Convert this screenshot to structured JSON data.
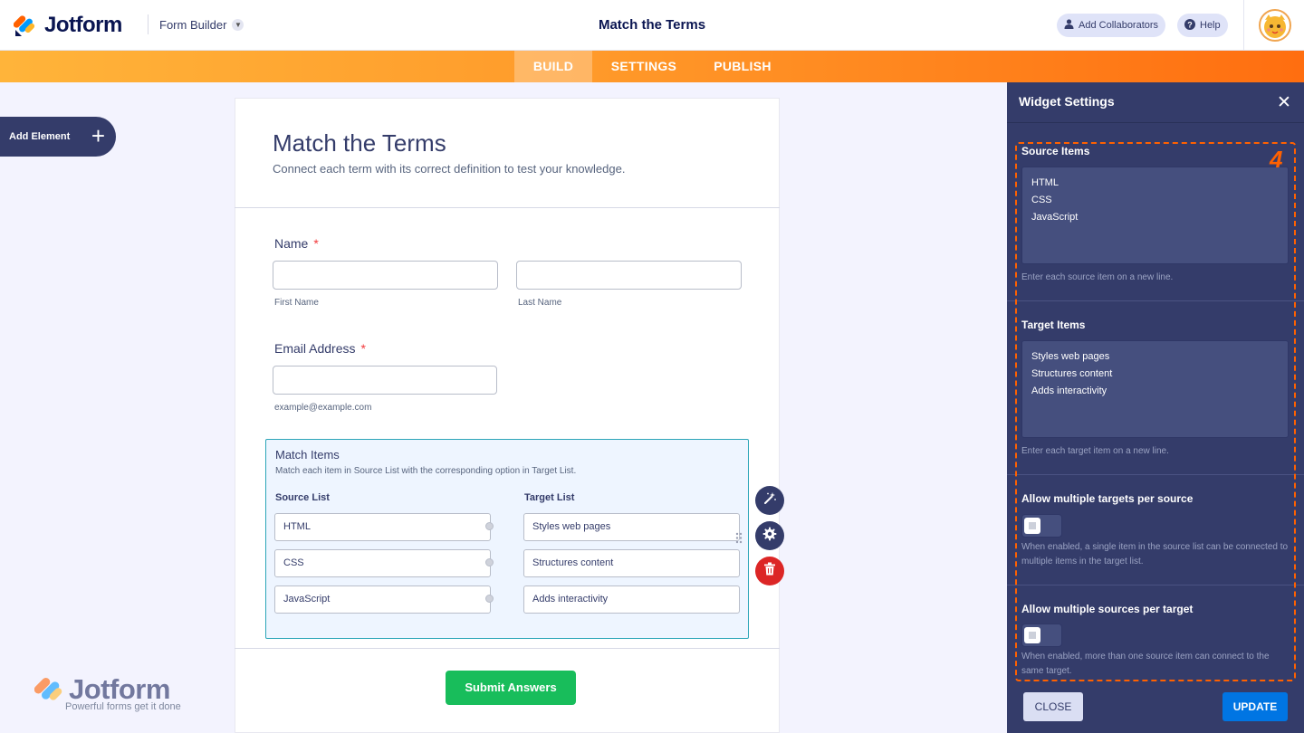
{
  "header": {
    "logo_text": "Jotform",
    "form_builder_label": "Form Builder",
    "page_title": "Match the Terms",
    "add_collaborators_label": "Add Collaborators",
    "help_label": "Help"
  },
  "nav": {
    "tabs": [
      {
        "label": "BUILD",
        "active": true
      },
      {
        "label": "SETTINGS",
        "active": false
      },
      {
        "label": "PUBLISH",
        "active": false
      }
    ]
  },
  "sidebar": {
    "add_element_label": "Add Element"
  },
  "form": {
    "title": "Match the Terms",
    "subtitle": "Connect each term with its correct definition to test your knowledge.",
    "name_label": "Name",
    "required_mark": "*",
    "first_name_sublabel": "First Name",
    "last_name_sublabel": "Last Name",
    "email_label": "Email Address",
    "email_sublabel": "example@example.com",
    "submit_label": "Submit Answers"
  },
  "widget": {
    "title": "Match Items",
    "description": "Match each item in Source List with the corresponding option in Target List.",
    "source_header": "Source List",
    "target_header": "Target List",
    "source_items": [
      "HTML",
      "CSS",
      "JavaScript"
    ],
    "target_items": [
      "Styles web pages",
      "Structures content",
      "Adds interactivity"
    ]
  },
  "watermark": {
    "logo_text": "Jotform",
    "tagline": "Powerful forms get it done"
  },
  "panel": {
    "title": "Widget Settings",
    "badge": "4",
    "source_label": "Source Items",
    "source_items": [
      "HTML",
      "CSS",
      "JavaScript"
    ],
    "source_help": "Enter each source item on a new line.",
    "target_label": "Target Items",
    "target_items": [
      "Styles web pages",
      "Structures content",
      "Adds interactivity"
    ],
    "target_help": "Enter each target item on a new line.",
    "multi_targets_label": "Allow multiple targets per source",
    "multi_targets_help": "When enabled, a single item in the source list can be connected to multiple items in the target list.",
    "multi_targets_on": false,
    "multi_sources_label": "Allow multiple sources per target",
    "multi_sources_help": "When enabled, more than one source item can connect to the same target.",
    "multi_sources_on": false,
    "close_label": "CLOSE",
    "update_label": "UPDATE"
  },
  "colors": {
    "brand_orange": "#ff6100",
    "navy": "#0a1551",
    "panel_bg": "#343c6a",
    "submit_green": "#18bd5b",
    "update_blue": "#0075e3",
    "delete_red": "#dc2626"
  },
  "icons": {
    "logo": "jotform-logo-icon",
    "collaborators": "user-icon",
    "help": "question-icon",
    "add": "plus-icon",
    "wand": "magic-wand-icon",
    "settings": "gear-icon",
    "delete": "trash-icon",
    "close": "close-icon",
    "drag": "drag-handle-icon"
  }
}
